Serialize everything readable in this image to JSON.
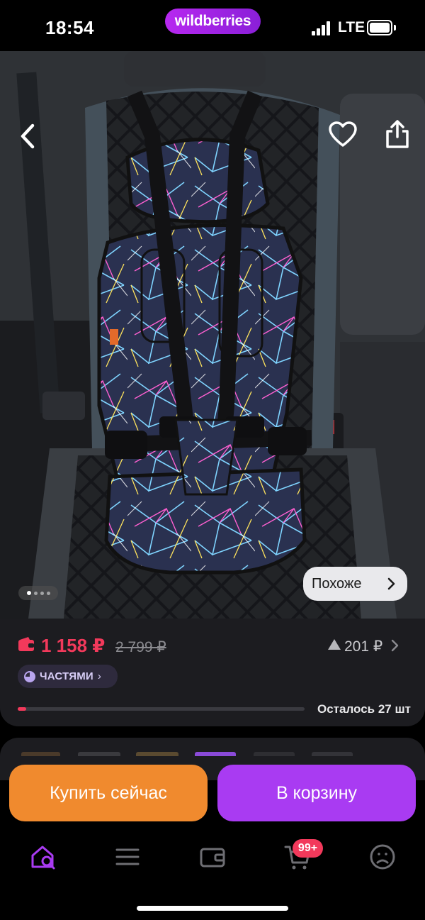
{
  "status_bar": {
    "time": "18:54",
    "network": "LTE",
    "brand": "wildberries"
  },
  "gallery": {
    "total_images": 4,
    "active_index": 0,
    "similar_label": "Похоже"
  },
  "price": {
    "current": "1 158 ₽",
    "old": "2 799 ₽",
    "difference": "201 ₽",
    "installments_label": "ЧАСТЯМИ",
    "stock_label": "Осталось 27 шт",
    "colors": {
      "accent_red": "#f2395b",
      "installments_bg": "#2e2a3d"
    }
  },
  "actions": {
    "buy_now": "Купить сейчас",
    "add_to_cart": "В корзину",
    "colors": {
      "buy_now": "#f08a2e",
      "add_to_cart": "#a93bf2"
    }
  },
  "tabbar": {
    "items": [
      {
        "icon": "home-search-icon",
        "active": true
      },
      {
        "icon": "catalog-icon",
        "active": false
      },
      {
        "icon": "wallet-icon",
        "active": false
      },
      {
        "icon": "cart-icon",
        "active": false,
        "badge": "99+"
      },
      {
        "icon": "profile-icon",
        "active": false
      }
    ]
  }
}
